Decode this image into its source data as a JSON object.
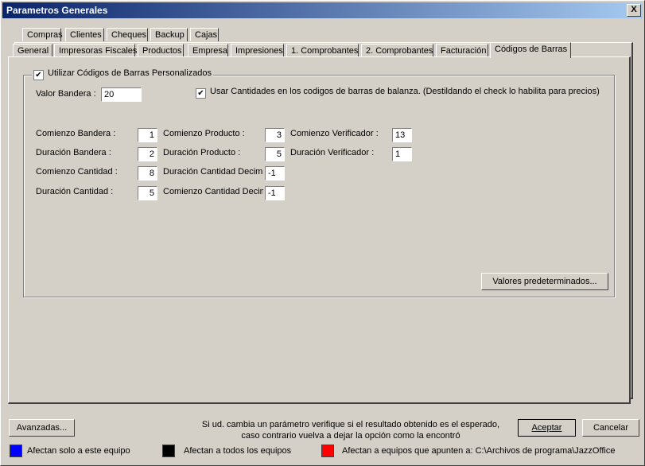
{
  "window": {
    "title": "Parametros Generales",
    "close_label": "X"
  },
  "tabs_row1": [
    "Compras",
    "Clientes",
    "Cheques",
    "Backup",
    "Cajas"
  ],
  "tabs_row2": [
    "General",
    "Impresoras Fiscales",
    "Productos",
    "Empresa",
    "Impresiones",
    "1. Comprobantes",
    "2. Comprobantes",
    "Facturación",
    "Códigos de Barras"
  ],
  "active_tab": "Códigos de Barras",
  "group": {
    "label": "Utilizar Códigos de Barras Personalizados",
    "checked": true,
    "check_mark": "✔"
  },
  "valor_bandera": {
    "label": "Valor Bandera :",
    "value": "20"
  },
  "usar_cantidades": {
    "label": "Usar Cantidades en los codigos de barras de balanza. (Destildando el check lo habilita para precios)",
    "checked": true
  },
  "fields": {
    "comienzo_bandera": {
      "label": "Comienzo Bandera :",
      "value": "1"
    },
    "duracion_bandera": {
      "label": "Duración Bandera :",
      "value": "2"
    },
    "comienzo_cantidad": {
      "label": "Comienzo Cantidad :",
      "value": "8"
    },
    "duracion_cantidad": {
      "label": "Duración Cantidad :",
      "value": "5"
    },
    "comienzo_producto": {
      "label": "Comienzo Producto :",
      "value": "3"
    },
    "duracion_producto": {
      "label": "Duración Producto :",
      "value": "5"
    },
    "duracion_cantidad_decimal": {
      "label": "Duración Cantidad Decima",
      "value": "-1"
    },
    "comienzo_cantidad_decimal": {
      "label": "Comienzo Cantidad Decima",
      "value": "-1"
    },
    "comienzo_verificador": {
      "label": "Comienzo Verificador :",
      "value": "13"
    },
    "duracion_verificador": {
      "label": "Duración Verificador :",
      "value": "1"
    }
  },
  "defaults_button": "Valores predeterminados...",
  "footer": {
    "advanced_button": "Avanzadas...",
    "notice_line1": "Si ud. cambia un parámetro verifique si el resultado obtenido es el esperado,",
    "notice_line2": "caso contrario vuelva a dejar la opción como la encontró",
    "accept_button": "Aceptar",
    "cancel_button": "Cancelar"
  },
  "legend": [
    {
      "color": "#0000ff",
      "label": "Afectan solo a este equipo"
    },
    {
      "color": "#000000",
      "label": "Afectan a todos los equipos"
    },
    {
      "color": "#ff0000",
      "label": "Afectan a equipos que apunten a: C:\\Archivos de programa\\JazzOffice"
    }
  ]
}
